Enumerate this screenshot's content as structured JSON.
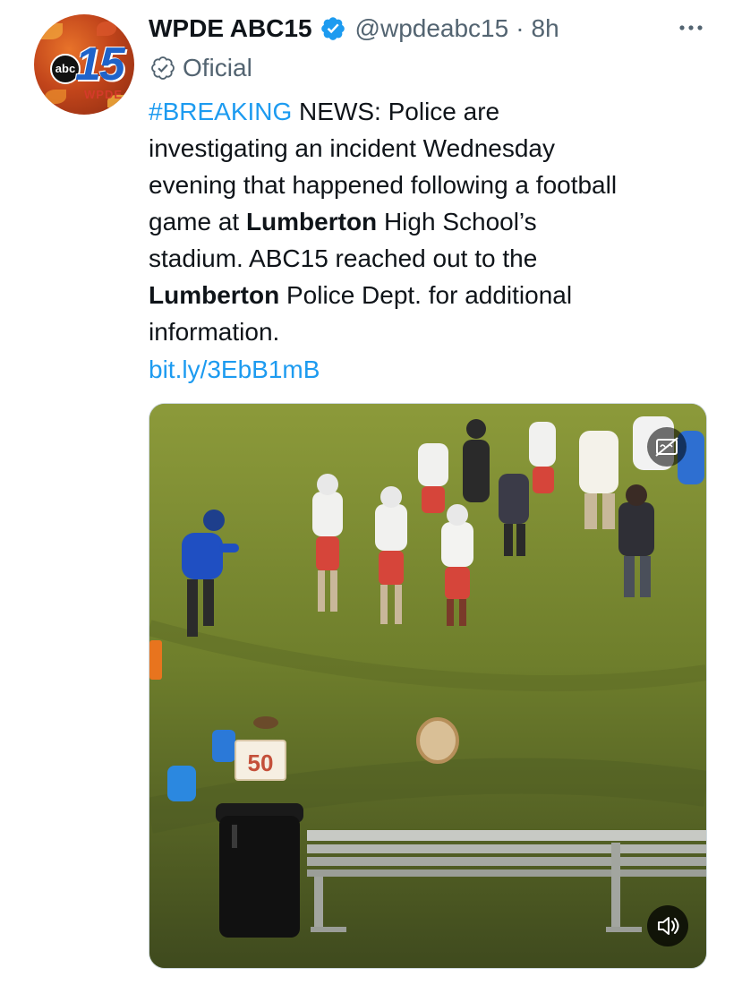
{
  "account": {
    "display_name": "WPDE ABC15",
    "handle": "@wpdeabc15",
    "separator": "·",
    "time_ago": "8h",
    "label": "Oficial",
    "avatar_text": {
      "network": "abc",
      "channel": "15",
      "station": "WPDE"
    }
  },
  "tweet": {
    "lines": [
      [
        {
          "text": "#BREAKING",
          "style": "hashtag"
        },
        {
          "text": " NEWS:  Police are",
          "style": "normal"
        }
      ],
      [
        {
          "text": "investigating an incident Wednesday",
          "style": "normal"
        }
      ],
      [
        {
          "text": "evening that happened following a football",
          "style": "normal"
        }
      ],
      [
        {
          "text": "game at ",
          "style": "normal"
        },
        {
          "text": "Lumberton",
          "style": "bold"
        },
        {
          "text": " High School’s",
          "style": "normal"
        }
      ],
      [
        {
          "text": "stadium. ABC15 reached out to the",
          "style": "normal"
        }
      ],
      [
        {
          "text": "Lumberton",
          "style": "bold"
        },
        {
          "text": " Police Dept. for additional",
          "style": "normal"
        }
      ],
      [
        {
          "text": "information.",
          "style": "normal"
        }
      ]
    ],
    "link": "bit.ly/3EbB1mB"
  },
  "media": {
    "type": "video",
    "yard_marker": "50",
    "controls": {
      "captions_icon": "closed-captions-off-icon",
      "volume_icon": "volume-icon"
    }
  },
  "icons": {
    "verified": "verified-badge-icon",
    "official": "official-label-icon",
    "more": "more-options-icon"
  },
  "colors": {
    "accent": "#1d9bf0",
    "text": "#0f1419",
    "secondary_text": "#536471",
    "field_green": "#7a8a2e"
  }
}
